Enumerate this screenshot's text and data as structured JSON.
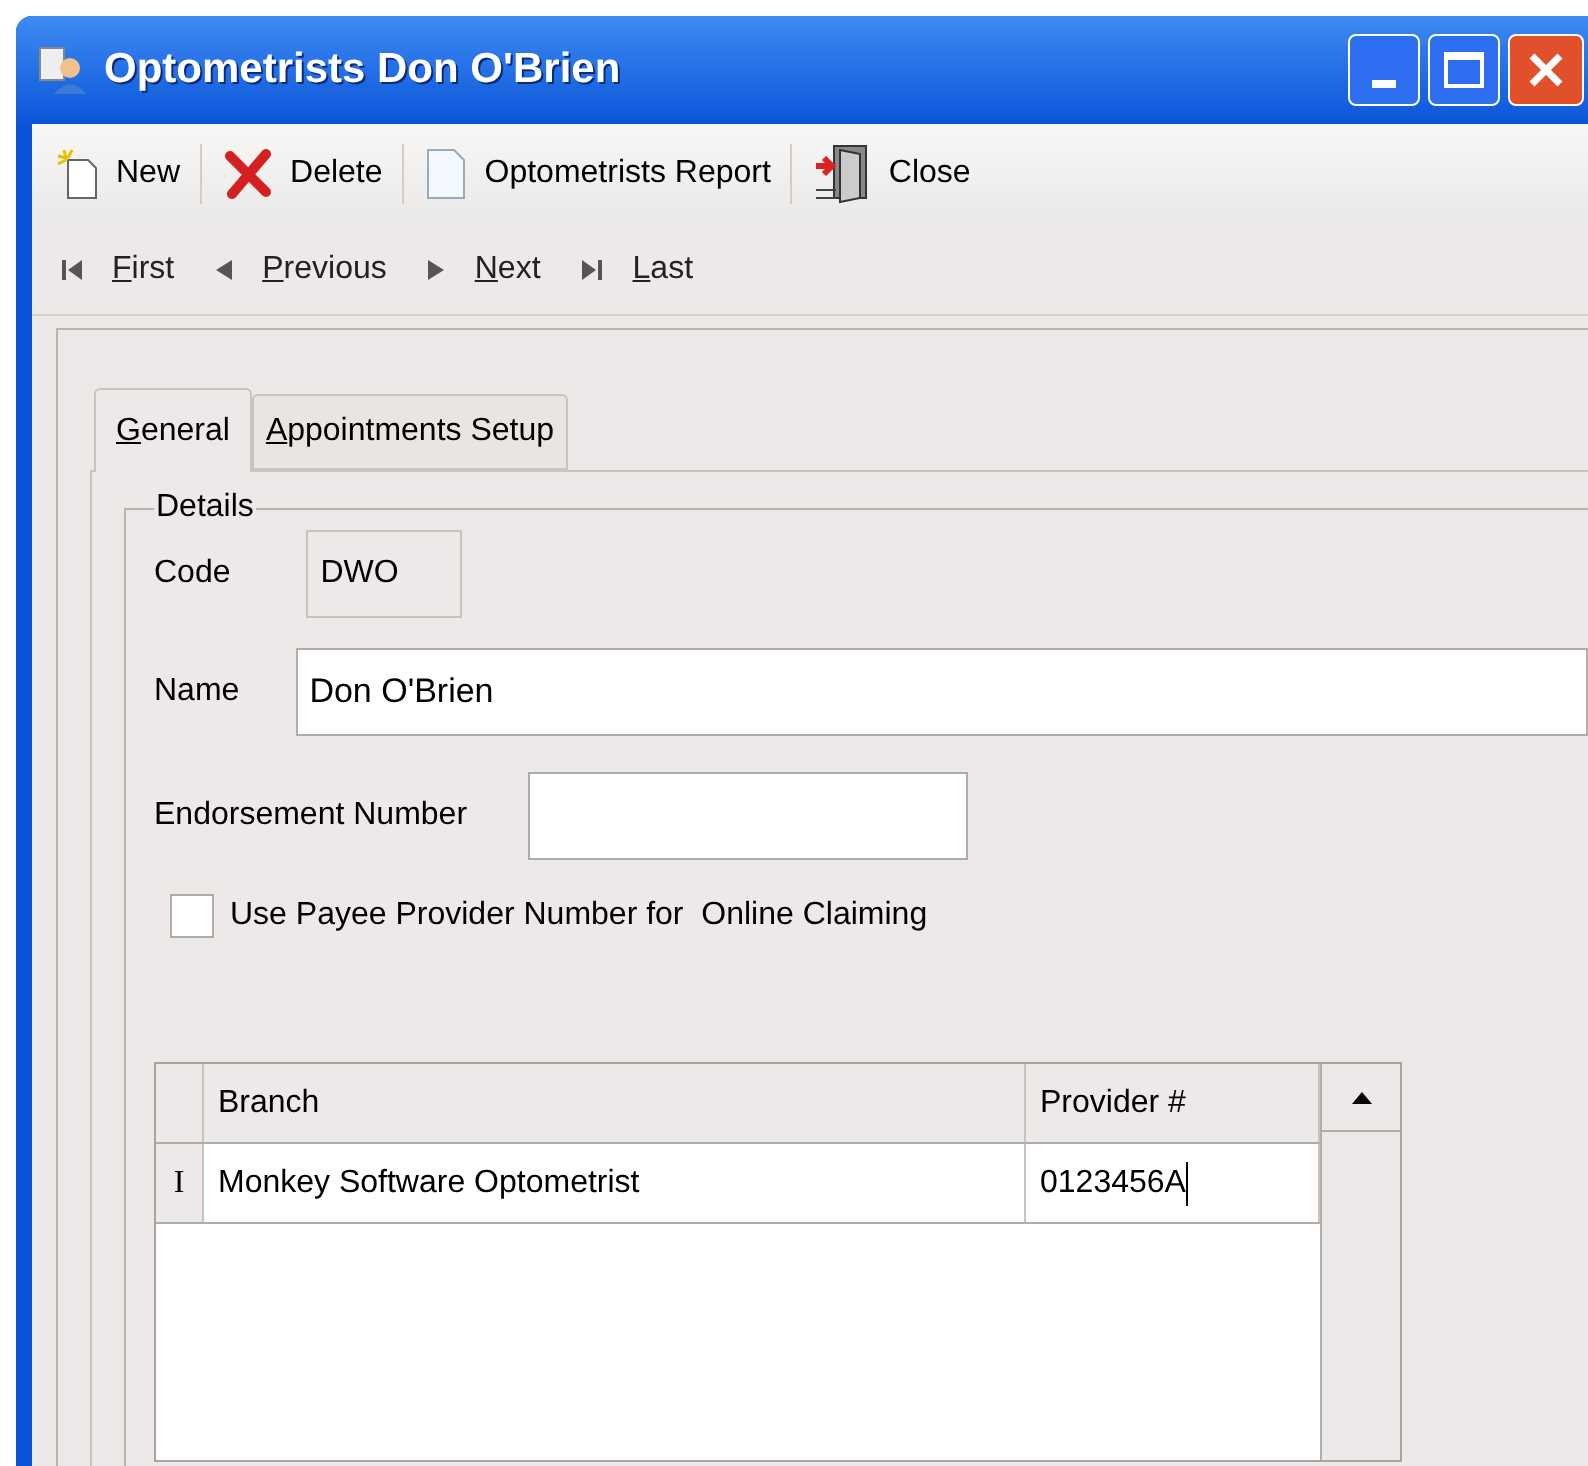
{
  "window": {
    "title": "Optometrists Don O'Brien"
  },
  "toolbar": [
    {
      "kind": "new",
      "label": "New"
    },
    {
      "kind": "delete",
      "label": "Delete"
    },
    {
      "kind": "report",
      "label": "Optometrists Report"
    },
    {
      "kind": "close",
      "label": "Close"
    }
  ],
  "navigation": [
    {
      "kind": "first",
      "label": "First"
    },
    {
      "kind": "previous",
      "label": "Previous"
    },
    {
      "kind": "next",
      "label": "Next"
    },
    {
      "kind": "last",
      "label": "Last"
    }
  ],
  "tabs": [
    {
      "label": "General",
      "selected": true
    },
    {
      "label": "Appointments Setup",
      "selected": false
    }
  ],
  "details": {
    "title": "Details",
    "code": {
      "label": "Code",
      "value": "DWO"
    },
    "name": {
      "label": "Name",
      "value": "Don O'Brien"
    },
    "endorsement": {
      "label": "Endorsement Number"
    },
    "payee_checkbox": {
      "label": "Use Payee Provider Number for  Online Claiming",
      "checked": false
    }
  },
  "table": {
    "columns": [
      "Branch",
      "Provider #"
    ],
    "rows": [
      {
        "indicator": "I",
        "cells": [
          "Monkey Software Optometrist",
          "0123456A"
        ],
        "editing": true
      }
    ]
  }
}
